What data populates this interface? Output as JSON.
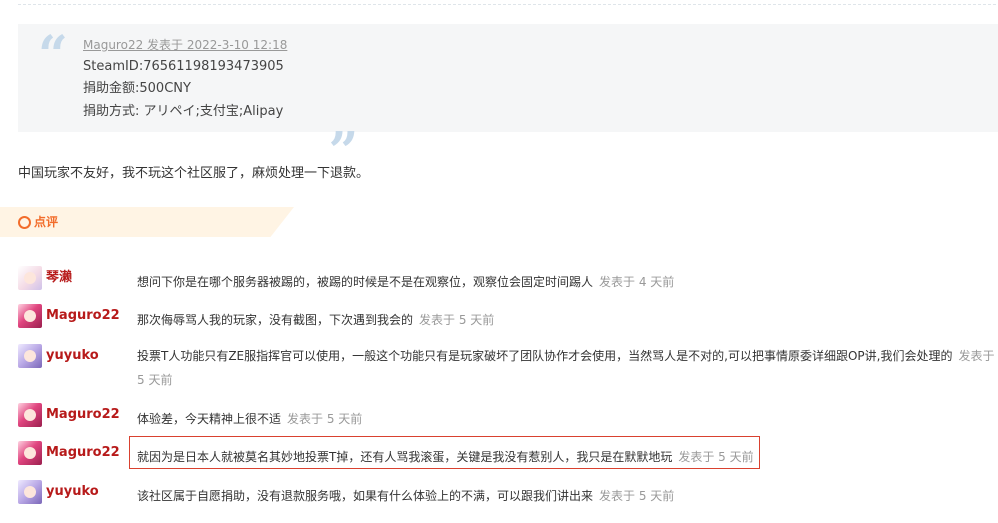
{
  "quote": {
    "author_line": "Maguro22 发表于 2022-3-10 12:18",
    "lines": [
      "SteamID:76561198193473905",
      "捐助金额:500CNY",
      "捐助方式: アリペイ;支付宝;Alipay"
    ]
  },
  "post_body": "中国玩家不友好，我不玩这个社区服了，麻烦处理一下退款。",
  "review": {
    "title": "点评"
  },
  "comments": [
    {
      "author": "琴濑",
      "text": "想问下你是在哪个服务器被踢的，被踢的时候是不是在观察位，观察位会固定时间踢人",
      "posted": "发表于 4 天前"
    },
    {
      "author": "Maguro22",
      "text": "那次侮辱骂人我的玩家，没有截图，下次遇到我会的",
      "posted": "发表于 5 天前"
    },
    {
      "author": "yuyuko",
      "text": "投票T人功能只有ZE服指挥官可以使用，一般这个功能只有是玩家破坏了团队协作才会使用，当然骂人是不对的,可以把事情原委详细跟OP讲,我们会处理的",
      "posted": "发表于 5 天前"
    },
    {
      "author": "Maguro22",
      "text": "体验差，今天精神上很不适",
      "posted": "发表于 5 天前"
    },
    {
      "author": "Maguro22",
      "text": "就因为是日本人就被莫名其妙地投票T掉，还有人骂我滚蛋，关键是我没有惹别人，我只是在默默地玩",
      "posted": "发表于 5 天前"
    },
    {
      "author": "yuyuko",
      "text": "该社区属于自愿捐助，没有退款服务哦，如果有什么体验上的不满，可以跟我们讲出来",
      "posted": "发表于 5 天前"
    }
  ],
  "colors": {
    "author": "#b71a1a",
    "accent": "#f26c2a",
    "highlight_border": "#d9412f"
  }
}
